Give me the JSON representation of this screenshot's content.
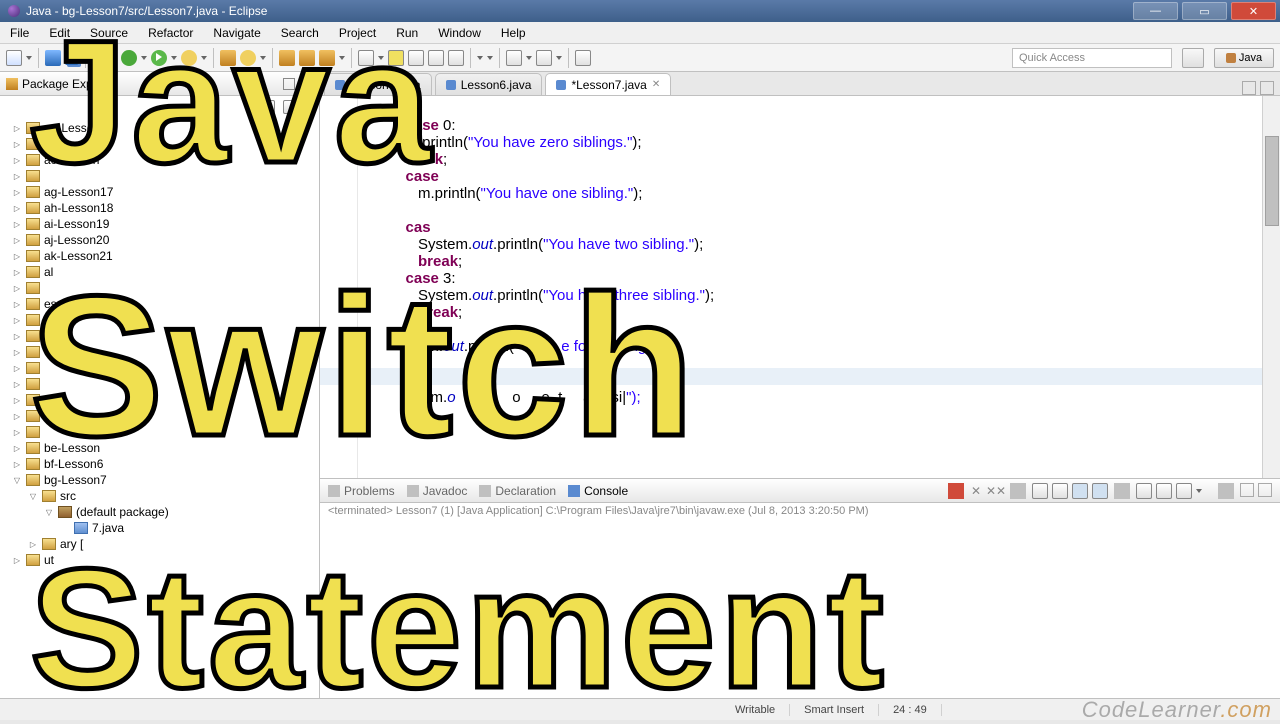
{
  "titlebar": {
    "text": "Java - bg-Lesson7/src/Lesson7.java - Eclipse"
  },
  "menu": [
    "File",
    "Edit",
    "Source",
    "Refactor",
    "Navigate",
    "Search",
    "Project",
    "Run",
    "Window",
    "Help"
  ],
  "quickaccess": "Quick Access",
  "perspective": "Java",
  "package_explorer": {
    "title": "Package Explo",
    "items": [
      {
        "label": "aa-Lesson",
        "exp": "col",
        "d": 0
      },
      {
        "label": "ab-Lesson",
        "exp": "col",
        "d": 0
      },
      {
        "label": "ac-Lesson",
        "exp": "col",
        "d": 0
      },
      {
        "label": "",
        "exp": "col",
        "d": 0
      },
      {
        "label": "ag-Lesson17",
        "exp": "col",
        "d": 0
      },
      {
        "label": "ah-Lesson18",
        "exp": "col",
        "d": 0
      },
      {
        "label": "ai-Lesson19",
        "exp": "col",
        "d": 0
      },
      {
        "label": "aj-Lesson20",
        "exp": "col",
        "d": 0
      },
      {
        "label": "ak-Lesson21",
        "exp": "col",
        "d": 0
      },
      {
        "label": "al",
        "exp": "col",
        "d": 0
      },
      {
        "label": "",
        "exp": "col",
        "d": 0
      },
      {
        "label": "esson",
        "exp": "col",
        "d": 0
      },
      {
        "label": "",
        "exp": "col",
        "d": 0
      },
      {
        "label": "",
        "exp": "col",
        "d": 0
      },
      {
        "label": "esson",
        "exp": "col",
        "d": 0
      },
      {
        "label": "",
        "exp": "col",
        "d": 0
      },
      {
        "label": "",
        "exp": "col",
        "d": 0
      },
      {
        "label": "",
        "exp": "col",
        "d": 0
      },
      {
        "label": "",
        "exp": "col",
        "d": 0
      },
      {
        "label": "",
        "exp": "col",
        "d": 0
      },
      {
        "label": "be-Lesson",
        "exp": "col",
        "d": 0
      },
      {
        "label": "bf-Lesson6",
        "exp": "col",
        "d": 0
      },
      {
        "label": "bg-Lesson7",
        "exp": "open",
        "d": 0
      },
      {
        "label": "src",
        "exp": "open",
        "d": 1,
        "ico": "src"
      },
      {
        "label": "(default package)",
        "exp": "open",
        "d": 2,
        "ico": "pkg"
      },
      {
        "label": "7.java",
        "exp": "",
        "d": 3,
        "ico": "java"
      },
      {
        "label": "ary [",
        "exp": "col",
        "d": 1,
        "ico": "src"
      },
      {
        "label": "ut",
        "exp": "col",
        "d": 0
      }
    ]
  },
  "editor_tabs": [
    {
      "label": "Lesson5.java",
      "active": false
    },
    {
      "label": "Lesson6.java",
      "active": false
    },
    {
      "label": "*Lesson7.java",
      "active": true
    }
  ],
  "code": {
    "l1a": "case",
    "l1b": " 0:",
    "l2a": "            ",
    "l2b": ".println(",
    "l2s": "\"You have zero siblings.\"",
    "l2c": ");",
    "l3a": "                ",
    "l3k": "k",
    "l3c": ";",
    "l4a": "case",
    "l5a": "            ",
    "l5b": "m.println(",
    "l5s": "\"You have one sibling.\"",
    "l5c": ");",
    "l6a": "cas",
    "l7a": "            System.",
    "l7o": "out",
    "l7b": ".println(",
    "l7s": "\"You have two sibling.\"",
    "l7c": ");",
    "l8a": "            ",
    "l8k": "break",
    "l8c": ";",
    "l9a": "         ",
    "l9k": "case",
    "l9b": " 3:",
    "l10a": "            System.",
    "l10o": "out",
    "l10b": ".println(",
    "l10s": "\"You have three sibling.\"",
    "l10c": ");",
    "l11a": "            ",
    "l11k": "break",
    "l11c": ";",
    "l12a": "            se",
    "l13a": "              m.",
    "l13o": "out",
    "l13b": ".println(",
    "l13s": "\"Yo      e four sibling.\"",
    "l13c": ");",
    "l14a": "         ef",
    "l15a": "               m.",
    "l15o": "o",
    "l15b": "   intln    o     e  t     any si|",
    "l15c": "\");"
  },
  "console_tabs": [
    "Problems",
    "Javadoc",
    "Declaration",
    "Console"
  ],
  "console_info": "<terminated> Lesson7 (1) [Java Application] C:\\Program Files\\Java\\jre7\\bin\\javaw.exe (Jul 8, 2013 3:20:50 PM)",
  "status": {
    "writable": "Writable",
    "insert": "Smart Insert",
    "pos": "24 : 49"
  },
  "brand": "CodeLearner",
  "overlay": {
    "l1": "Java",
    "l2": "Switch",
    "l3": "Statement"
  }
}
